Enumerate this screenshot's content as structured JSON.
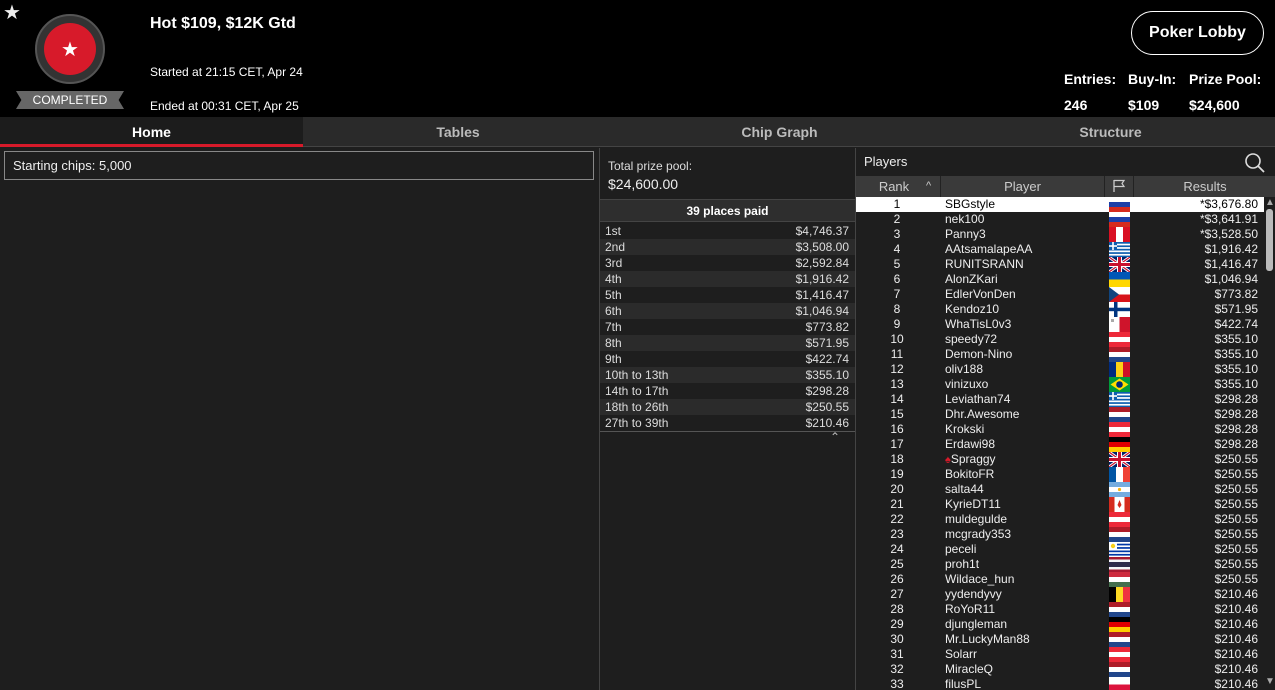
{
  "header": {
    "title": "Hot $109, $12K Gtd",
    "status": "COMPLETED",
    "started": "Started at 21:15 CET, Apr 24",
    "ended": "Ended at 00:31 CET, Apr 25",
    "lobby_button": "Poker Lobby",
    "stats": {
      "entries_label": "Entries:",
      "entries_value": "246",
      "buyin_label": "Buy-In:",
      "buyin_value": "$109",
      "prizepool_label": "Prize Pool:",
      "prizepool_value": "$24,600"
    }
  },
  "tabs": [
    {
      "label": "Home",
      "active": true
    },
    {
      "label": "Tables",
      "active": false
    },
    {
      "label": "Chip Graph",
      "active": false
    },
    {
      "label": "Structure",
      "active": false
    }
  ],
  "home": {
    "starting_chips_label": "Starting chips:",
    "starting_chips_value": "5,000"
  },
  "prizes": {
    "total_label": "Total prize pool:",
    "total_value": "$24,600.00",
    "places_paid": "39 places paid",
    "rows": [
      {
        "place": "1st",
        "amount": "$4,746.37"
      },
      {
        "place": "2nd",
        "amount": "$3,508.00"
      },
      {
        "place": "3rd",
        "amount": "$2,592.84"
      },
      {
        "place": "4th",
        "amount": "$1,916.42"
      },
      {
        "place": "5th",
        "amount": "$1,416.47"
      },
      {
        "place": "6th",
        "amount": "$1,046.94"
      },
      {
        "place": "7th",
        "amount": "$773.82"
      },
      {
        "place": "8th",
        "amount": "$571.95"
      },
      {
        "place": "9th",
        "amount": "$422.74"
      },
      {
        "place": "10th to 13th",
        "amount": "$355.10"
      },
      {
        "place": "14th to 17th",
        "amount": "$298.28"
      },
      {
        "place": "18th to 26th",
        "amount": "$250.55"
      },
      {
        "place": "27th to 39th",
        "amount": "$210.46"
      }
    ]
  },
  "players": {
    "title": "Players",
    "columns": {
      "rank": "Rank",
      "player": "Player",
      "results": "Results"
    },
    "rows": [
      {
        "rank": "1",
        "name": "SBGstyle",
        "result": "*$3,676.80",
        "flag": "ru"
      },
      {
        "rank": "2",
        "name": "nek100",
        "result": "*$3,641.91",
        "flag": "ru"
      },
      {
        "rank": "3",
        "name": "Panny3",
        "result": "*$3,528.50",
        "flag": "pe"
      },
      {
        "rank": "4",
        "name": "AAtsamalapeAA",
        "result": "$1,916.42",
        "flag": "gr"
      },
      {
        "rank": "5",
        "name": "RUNITSRANN",
        "result": "$1,416.47",
        "flag": "gb"
      },
      {
        "rank": "6",
        "name": "AlonZKari",
        "result": "$1,046.94",
        "flag": "ua"
      },
      {
        "rank": "7",
        "name": "EdlerVonDen",
        "result": "$773.82",
        "flag": "cz"
      },
      {
        "rank": "8",
        "name": "Kendoz10",
        "result": "$571.95",
        "flag": "fi"
      },
      {
        "rank": "9",
        "name": "WhaTisL0v3",
        "result": "$422.74",
        "flag": "mt"
      },
      {
        "rank": "10",
        "name": "speedy72",
        "result": "$355.10",
        "flag": "at"
      },
      {
        "rank": "11",
        "name": "Demon-Nino",
        "result": "$355.10",
        "flag": "nl"
      },
      {
        "rank": "12",
        "name": "oliv188",
        "result": "$355.10",
        "flag": "ro"
      },
      {
        "rank": "13",
        "name": "vinizuxo",
        "result": "$355.10",
        "flag": "br"
      },
      {
        "rank": "14",
        "name": "Leviathan74",
        "result": "$298.28",
        "flag": "gr"
      },
      {
        "rank": "15",
        "name": "Dhr.Awesome",
        "result": "$298.28",
        "flag": "nl"
      },
      {
        "rank": "16",
        "name": "Krokski",
        "result": "$298.28",
        "flag": "at"
      },
      {
        "rank": "17",
        "name": "Erdawi98",
        "result": "$298.28",
        "flag": "de"
      },
      {
        "rank": "18",
        "name": "Spraggy",
        "result": "$250.55",
        "flag": "gb",
        "pro": true
      },
      {
        "rank": "19",
        "name": "BokitoFR",
        "result": "$250.55",
        "flag": "fr"
      },
      {
        "rank": "20",
        "name": "salta44",
        "result": "$250.55",
        "flag": "ar"
      },
      {
        "rank": "21",
        "name": "KyrieDT11",
        "result": "$250.55",
        "flag": "ca"
      },
      {
        "rank": "22",
        "name": "muldegulde",
        "result": "$250.55",
        "flag": "at"
      },
      {
        "rank": "23",
        "name": "mcgrady353",
        "result": "$250.55",
        "flag": "nl"
      },
      {
        "rank": "24",
        "name": "peceli",
        "result": "$250.55",
        "flag": "uy"
      },
      {
        "rank": "25",
        "name": "proh1t",
        "result": "$250.55",
        "flag": "th"
      },
      {
        "rank": "26",
        "name": "Wildace_hun",
        "result": "$250.55",
        "flag": "hu"
      },
      {
        "rank": "27",
        "name": "yydendyvy",
        "result": "$210.46",
        "flag": "be"
      },
      {
        "rank": "28",
        "name": "RoYoR11",
        "result": "$210.46",
        "flag": "nl"
      },
      {
        "rank": "29",
        "name": "djungleman",
        "result": "$210.46",
        "flag": "de"
      },
      {
        "rank": "30",
        "name": "Mr.LuckyMan88",
        "result": "$210.46",
        "flag": "nl"
      },
      {
        "rank": "31",
        "name": "Solarr",
        "result": "$210.46",
        "flag": "at"
      },
      {
        "rank": "32",
        "name": "MiracleQ",
        "result": "$210.46",
        "flag": "nl"
      },
      {
        "rank": "33",
        "name": "filusPL",
        "result": "$210.46",
        "flag": "pl"
      }
    ]
  },
  "colors": {
    "accent": "#d71a2a",
    "header_bg": "#000000",
    "panel_bg": "#1e1e1e"
  }
}
